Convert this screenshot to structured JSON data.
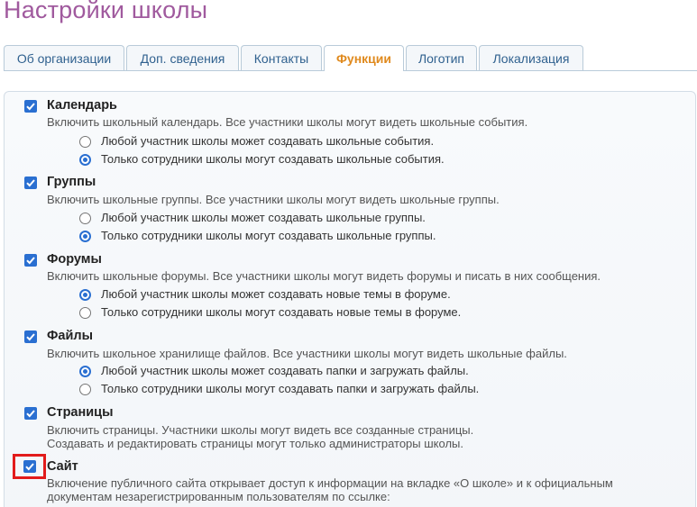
{
  "page": {
    "title": "Настройки школы"
  },
  "tabs": [
    {
      "label": "Об организации",
      "active": false
    },
    {
      "label": "Доп. сведения",
      "active": false
    },
    {
      "label": "Контакты",
      "active": false
    },
    {
      "label": "Функции",
      "active": true
    },
    {
      "label": "Логотип",
      "active": false
    },
    {
      "label": "Локализация",
      "active": false
    }
  ],
  "colors": {
    "title": "#a05a9e",
    "active_tab": "#e08a1e",
    "tab_text": "#30618f",
    "checkbox": "#2a6fd1",
    "highlight": "#e21b1b"
  },
  "sections": [
    {
      "title": "Календарь",
      "checked": true,
      "description": "Включить школьный календарь. Все участники школы могут видеть школьные события.",
      "options": [
        {
          "label": "Любой участник школы может создавать школьные события.",
          "selected": false
        },
        {
          "label": "Только сотрудники школы могут создавать школьные события.",
          "selected": true
        }
      ]
    },
    {
      "title": "Группы",
      "checked": true,
      "description": "Включить школьные группы. Все участники школы могут видеть школьные группы.",
      "options": [
        {
          "label": "Любой участник школы может создавать школьные группы.",
          "selected": false
        },
        {
          "label": "Только сотрудники школы могут создавать школьные группы.",
          "selected": true
        }
      ]
    },
    {
      "title": "Форумы",
      "checked": true,
      "description": "Включить школьные форумы. Все участники школы могут видеть форумы и писать в них сообщения.",
      "options": [
        {
          "label": "Любой участник школы может создавать новые темы в форуме.",
          "selected": true
        },
        {
          "label": "Только сотрудники школы могут создавать новые темы в форуме.",
          "selected": false
        }
      ]
    },
    {
      "title": "Файлы",
      "checked": true,
      "description": "Включить школьное хранилище файлов. Все участники школы могут видеть школьные файлы.",
      "options": [
        {
          "label": "Любой участник школы может создавать папки и загружать файлы.",
          "selected": true
        },
        {
          "label": "Только сотрудники школы могут создавать папки и загружать файлы.",
          "selected": false
        }
      ]
    },
    {
      "title": "Страницы",
      "checked": true,
      "description": "Включить страницы. Участники школы могут видеть все созданные страницы.",
      "description2": "Создавать и редактировать страницы могут только администраторы школы."
    },
    {
      "title": "Сайт",
      "checked": true,
      "highlighted": true,
      "description": "Включение публичного сайта открывает доступ к информации на вкладке «О школе» и к официальным",
      "description2": "документам незарегистрированным пользователям по ссылке:"
    }
  ]
}
